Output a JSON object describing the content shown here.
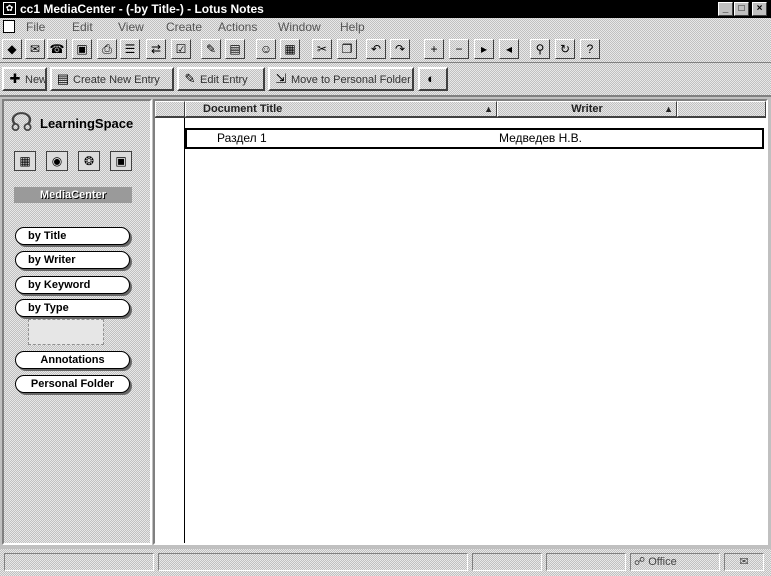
{
  "window": {
    "title": "cc1 MediaCenter - (-by Title-) - Lotus Notes",
    "title_icon": "lotus-icon",
    "minimize": "_",
    "maximize": "□",
    "close": "×"
  },
  "menu": {
    "doc_icon": "document-icon",
    "items": [
      "File",
      "Edit",
      "View",
      "Create",
      "Actions",
      "Window",
      "Help"
    ]
  },
  "smarticons": [
    {
      "name": "diamond-icon",
      "glyph": "◆"
    },
    {
      "name": "mail-icon",
      "glyph": "✉"
    },
    {
      "name": "phone-icon",
      "glyph": "☎"
    },
    {
      "name": "save-icon",
      "glyph": "▣"
    },
    {
      "name": "print-icon",
      "glyph": "⎙"
    },
    {
      "name": "list-icon",
      "glyph": "☰"
    },
    {
      "name": "navigate-icon",
      "glyph": "⇄"
    },
    {
      "name": "check-icon",
      "glyph": "☑"
    },
    {
      "name": "pencil-icon",
      "glyph": "✎"
    },
    {
      "name": "edit-document-icon",
      "glyph": "▤"
    },
    {
      "name": "person-icon",
      "glyph": "☺"
    },
    {
      "name": "properties-icon",
      "glyph": "▦"
    },
    {
      "name": "cut-icon",
      "glyph": "✂"
    },
    {
      "name": "copy-icon",
      "glyph": "❐"
    },
    {
      "name": "undo-icon",
      "glyph": "↶"
    },
    {
      "name": "redo-icon",
      "glyph": "↷"
    },
    {
      "name": "expand-icon",
      "glyph": "+"
    },
    {
      "name": "collapse-icon",
      "glyph": "−"
    },
    {
      "name": "next-icon",
      "glyph": "▸"
    },
    {
      "name": "previous-icon",
      "glyph": "◂"
    },
    {
      "name": "search-icon",
      "glyph": "⚲"
    },
    {
      "name": "refresh-icon",
      "glyph": "↻"
    },
    {
      "name": "help-icon",
      "glyph": "?"
    }
  ],
  "actionbar": [
    {
      "name": "new-button",
      "icon": "✚",
      "label": "New"
    },
    {
      "name": "create-new-entry-button",
      "icon": "▤",
      "label": "Create New Entry"
    },
    {
      "name": "edit-entry-button",
      "icon": "✎",
      "label": "Edit Entry"
    },
    {
      "name": "move-to-folder-button",
      "icon": "⇲",
      "label": "Move to Personal Folder"
    },
    {
      "name": "view-help-button",
      "icon": "◐",
      "label": ""
    }
  ],
  "navigator": {
    "logo_text": "LearningSpace",
    "icons": [
      {
        "name": "schedule-icon",
        "glyph": "▦"
      },
      {
        "name": "mediacenter-icon",
        "glyph": "◉"
      },
      {
        "name": "courseroom-icon",
        "glyph": "❂"
      },
      {
        "name": "profiles-icon",
        "glyph": "▣"
      }
    ],
    "section_label": "MediaCenter",
    "views": [
      "by Title",
      "by Writer",
      "by Keyword",
      "by Type"
    ],
    "extras": [
      "Annotations",
      "Personal Folder"
    ]
  },
  "view": {
    "columns": [
      {
        "label": "Document Title",
        "sort": "▲"
      },
      {
        "label": "Writer",
        "sort": "▲"
      }
    ],
    "rows": [
      {
        "title": "Раздел 1",
        "writer": "Медведев Н.В."
      }
    ]
  },
  "status": {
    "fields": [
      "",
      "",
      "",
      "",
      "Office"
    ],
    "mail_icon": "envelope-icon"
  }
}
